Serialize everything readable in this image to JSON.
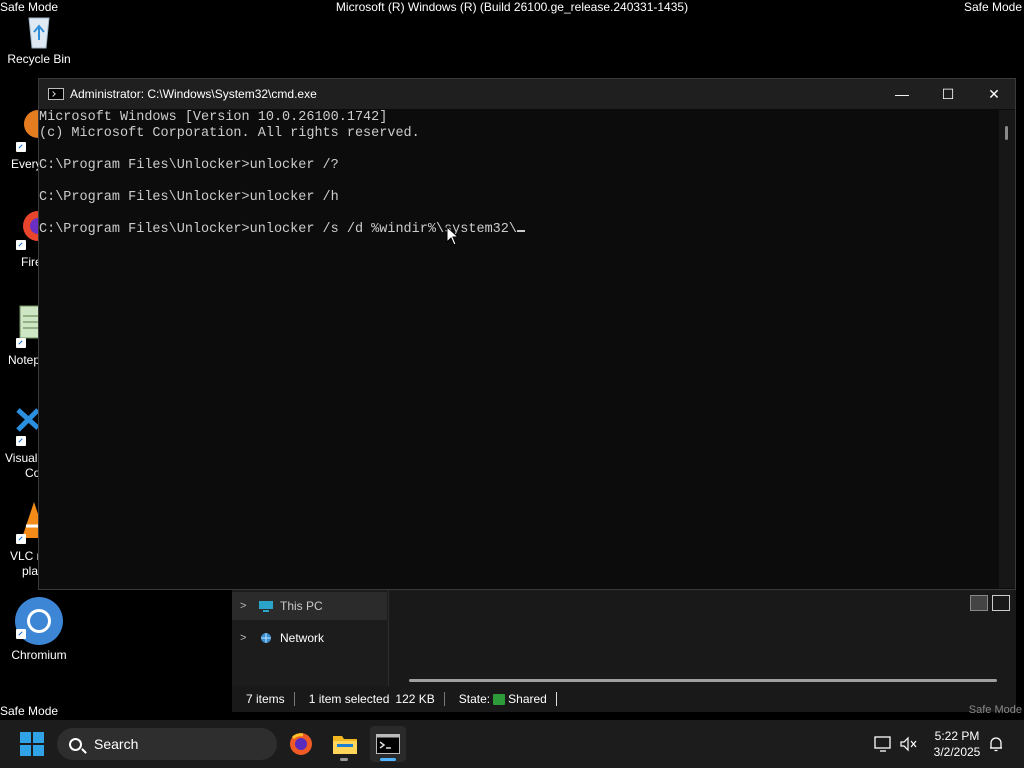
{
  "desktop": {
    "safe_mode_label": "Safe Mode",
    "build_text": "Microsoft (R) Windows (R) (Build 26100.ge_release.240331-1435)",
    "icons": [
      {
        "label": "Recycle Bin"
      },
      {
        "label": "Every"
      },
      {
        "label": "Fire"
      },
      {
        "label": "Notep"
      },
      {
        "label_line1": "Visual",
        "label_line2": "Co"
      },
      {
        "label_line1": "VLC r",
        "label_line2": "pla"
      },
      {
        "label": "Chromium"
      }
    ]
  },
  "cmd_window": {
    "title": "Administrator: C:\\Windows\\System32\\cmd.exe",
    "minimize_glyph": "—",
    "maximize_glyph": "☐",
    "close_glyph": "✕",
    "lines": [
      "Microsoft Windows [Version 10.0.26100.1742]",
      "(c) Microsoft Corporation. All rights reserved.",
      "",
      "C:\\Program Files\\Unlocker>unlocker /?",
      "",
      "C:\\Program Files\\Unlocker>unlocker /h",
      "",
      "C:\\Program Files\\Unlocker>unlocker /s /d %windir%\\system32\\"
    ]
  },
  "explorer": {
    "nav_items": [
      {
        "label": "This PC"
      },
      {
        "label": "Network"
      }
    ],
    "status": {
      "items_count": "7 items",
      "selection": "1 item selected",
      "size": "122 KB",
      "state_label": "State:",
      "state_value": "Shared"
    }
  },
  "taskbar": {
    "search_placeholder": "Search",
    "apps": [
      "firefox-icon",
      "file-explorer-icon",
      "terminal-icon"
    ],
    "time": "5:22 PM",
    "date": "3/2/2025"
  },
  "colors": {
    "accent": "#2fa3e6",
    "taskbar_bg": "#1c1c1c",
    "console_bg": "#0c0c0c",
    "console_text": "#cccccc"
  }
}
